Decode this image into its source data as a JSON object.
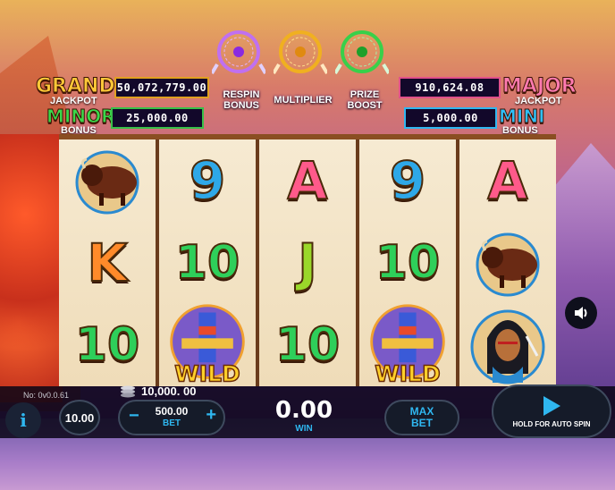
{
  "jackpots": {
    "grand": {
      "title": "GRAND",
      "sub": "JACKPOT",
      "value": "50,072,779.00"
    },
    "major": {
      "title": "MAJOR",
      "sub": "JACKPOT",
      "value": "910,624.08"
    },
    "minor": {
      "title": "MINOR",
      "sub": "BONUS",
      "value": "25,000.00"
    },
    "mini": {
      "title": "MINI",
      "sub": "BONUS",
      "value": "5,000.00"
    }
  },
  "features": [
    {
      "label_line1": "RESPIN",
      "label_line2": "BONUS",
      "color": "#b04ae8"
    },
    {
      "label_line1": "MULTIPLIER",
      "label_line2": "",
      "color": "#f0b020"
    },
    {
      "label_line1": "PRIZE",
      "label_line2": "BOOST",
      "color": "#38d04a"
    }
  ],
  "reels": [
    [
      "buffalo",
      "K",
      "10"
    ],
    [
      "9",
      "10",
      "WILD"
    ],
    [
      "A",
      "J",
      "10"
    ],
    [
      "9",
      "10",
      "WILD"
    ],
    [
      "A",
      "buffalo",
      "chief"
    ]
  ],
  "bottom": {
    "version": "No: 0v0.0.61",
    "balance": "10,000. 00",
    "quick_bet": "10.00",
    "bet_value": "500.00",
    "bet_label": "BET",
    "win_value": "0.00",
    "win_label": "WIN",
    "max_bet_line1": "MAX",
    "max_bet_line2": "BET",
    "autospin_label": "HOLD FOR AUTO SPIN",
    "minus": "−",
    "plus": "+",
    "info": "i"
  },
  "icons": {
    "info": "info-icon",
    "sound": "speaker-icon",
    "coins": "coin-stack-icon",
    "play": "play-icon"
  },
  "colors": {
    "accent": "#2fb7f0",
    "panel": "#151b29"
  }
}
